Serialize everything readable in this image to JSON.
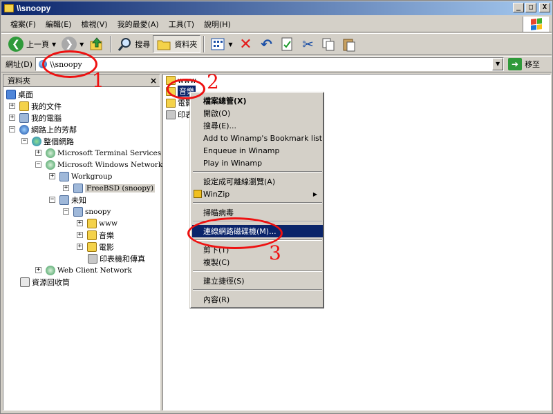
{
  "window": {
    "title": "\\\\snoopy"
  },
  "title_buttons": {
    "minimize": "_",
    "maximize": "□",
    "close": "X"
  },
  "menubar": [
    "檔案(F)",
    "編輯(E)",
    "檢視(V)",
    "我的最愛(A)",
    "工具(T)",
    "說明(H)"
  ],
  "toolbar": {
    "back_label": "上一頁",
    "search_label": "搜尋",
    "folders_label": "資料夾"
  },
  "address": {
    "label": "網址(D)",
    "value": "\\\\snoopy",
    "go_label": "移至"
  },
  "folders_pane": {
    "title": "資料夾",
    "close": "×"
  },
  "tree": [
    {
      "label": "桌面",
      "exp": ""
    },
    {
      "label": "我的文件",
      "exp": "+"
    },
    {
      "label": "我的電腦",
      "exp": "+"
    },
    {
      "label": "網路上的芳鄰",
      "exp": "−"
    },
    {
      "label": "整個網路",
      "exp": "−"
    },
    {
      "label": "Microsoft Terminal Services",
      "exp": "+"
    },
    {
      "label": "Microsoft Windows Network",
      "exp": "−"
    },
    {
      "label": "Workgroup",
      "exp": "+"
    },
    {
      "label": "FreeBSD (snoopy)",
      "exp": "+"
    },
    {
      "label": "未知",
      "exp": "−"
    },
    {
      "label": "snoopy",
      "exp": "−"
    },
    {
      "label": "www",
      "exp": "+"
    },
    {
      "label": "音樂",
      "exp": "+"
    },
    {
      "label": "電影",
      "exp": "+"
    },
    {
      "label": "印表機和傳真",
      "exp": ""
    },
    {
      "label": "Web Client Network",
      "exp": "+"
    },
    {
      "label": "資源回收筒",
      "exp": ""
    }
  ],
  "right_items": [
    "www",
    "音樂",
    "電影",
    "印表"
  ],
  "context_menu": [
    {
      "label": "檔案總管(X)",
      "bold": true
    },
    {
      "label": "開啟(O)"
    },
    {
      "label": "搜尋(E)..."
    },
    {
      "label": "Add to Winamp's Bookmark list"
    },
    {
      "label": "Enqueue in Winamp"
    },
    {
      "label": "Play in Winamp"
    },
    {
      "label": "設定成可離線瀏覽(A)"
    },
    {
      "label": "WinZip",
      "submenu": "▶"
    },
    {
      "label": "掃瞄病毒"
    },
    {
      "label": "連線網路磁碟機(M)...",
      "highlighted": true
    },
    {
      "label": "剪下(T)"
    },
    {
      "label": "複製(C)"
    },
    {
      "label": "建立捷徑(S)"
    },
    {
      "label": "內容(R)"
    }
  ],
  "annotations": [
    "1",
    "2",
    "3"
  ],
  "colors": {
    "title_start": "#0a246a",
    "title_end": "#a6caf0",
    "selection": "#0a246a",
    "annotation": "#ee1111",
    "face": "#d4d0c8"
  },
  "icons": {
    "back": "green-back-arrow-icon",
    "forward": "gray-forward-arrow-icon",
    "up": "folder-up-icon",
    "search": "magnifier-icon",
    "folders": "folder-icon",
    "views": "views-icon",
    "delete": "red-x-icon",
    "undo": "undo-icon",
    "properties": "properties-icon",
    "cut": "scissors-icon",
    "copy": "copy-icon",
    "paste": "paste-icon"
  }
}
